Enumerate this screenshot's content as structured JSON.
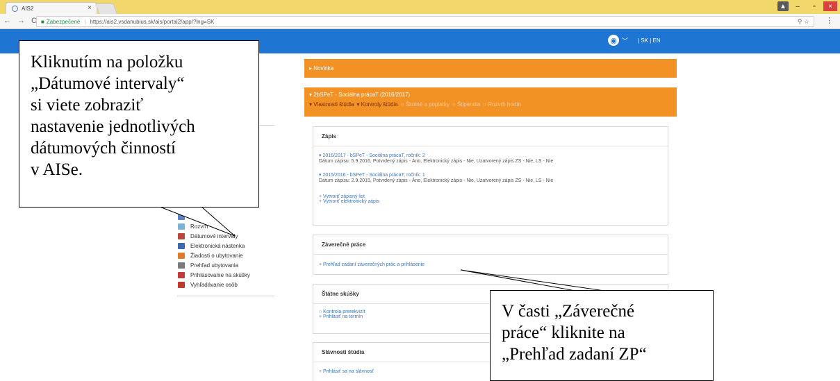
{
  "browser": {
    "tab_title": "AIS2",
    "tab_close": "×",
    "secure_label": "Zabezpečené",
    "separator": "|",
    "url": "https://ais2.vsdanubius.sk/ais/portal2/app/?lng=SK",
    "window_buttons": {
      "user": "▲",
      "minimize": "–",
      "maximize": "▫",
      "close": "×"
    },
    "nav": {
      "back": "←",
      "forward": "→",
      "reload": "C"
    },
    "omnibox_right": "⚲ ☆",
    "menu": "⋮"
  },
  "header": {
    "avatar": "◉",
    "chevron": "﹀",
    "lang_links": "| SK | EN"
  },
  "sidebar": {
    "items": [
      {
        "label": "...dmetov",
        "icon": "book-icon",
        "color": "#5b7fbf"
      },
      {
        "label": "Rozvrh",
        "icon": "schedule-icon",
        "color": "#7bb3d8"
      },
      {
        "label": "Dátumové intervaly",
        "icon": "calendar-icon",
        "color": "#b9473d"
      },
      {
        "label": "Elektronická nástenka",
        "icon": "board-icon",
        "color": "#3c68b0"
      },
      {
        "label": "Žiadosti o ubytovanie",
        "icon": "person-icon",
        "color": "#e07b2a"
      },
      {
        "label": "Prehľad ubytovania",
        "icon": "list-icon",
        "color": "#7a7a7a"
      },
      {
        "label": "Prihlasovanie na skúšky",
        "icon": "exam-icon",
        "color": "#c23b3b"
      },
      {
        "label": "Vyhľadávanie osôb",
        "icon": "people-icon",
        "color": "#c0392b"
      }
    ]
  },
  "main": {
    "novinka": "▸ Novinka",
    "study_title": "▾ 2bSPeT - Sociálna prácaT (2016/2017)",
    "study_links": [
      {
        "label": "▾ Vlastnosti štúdia",
        "active": true
      },
      {
        "label": "▾ Kontroly štúdia",
        "active": true
      },
      {
        "label": "○ Školné a poplatky",
        "active": false
      },
      {
        "label": "○ Štipendia",
        "active": false
      },
      {
        "label": "○ Rozvrh hodín",
        "active": false
      }
    ],
    "zapis": {
      "title": "Zápis",
      "entry1_link": "▾ 2016/2017 - bSPeT - Sociálna prácaT, ročník: 2",
      "entry1_text": "Dátum zápisu: 5.9.2016, Potvrdený zápis - Áno, Elektronický zápis - Nie, Uzatvorený zápis ZS - Nie, LS - Nie",
      "entry2_link": "▾ 2015/2016 - bSPeT - Sociálna prácaT, ročník: 1",
      "entry2_text": "Dátum zápisu: 2.9.2015, Potvrdený zápis - Áno, Elektronický zápis - Nie, Uzatvorený zápis ZS - Nie, LS - Nie",
      "action1": "+ Vytvoriť zápisný list",
      "action2": "+ Vytvoriť elektronický zápis"
    },
    "zaverecne": {
      "title": "Záverečné práce",
      "link": "+ Prehľad zadaní záverečných prác a prihlásenie"
    },
    "statne": {
      "title": "Štátne skúšky",
      "link1": "○ Kontrola prerekvizít",
      "link2": "+ Prihlásiť na termín"
    },
    "slavnosti": {
      "title": "Slávnosti štúdia",
      "link": "+ Prihlásiť sa na slávnosť"
    }
  },
  "callouts": {
    "first": [
      "Kliknutím na položku",
      "„Dátumové intervaly“",
      "si viete zobraziť",
      "nastavenie jednotlivých",
      "dátumových činností",
      "v AISe."
    ],
    "second": [
      "V časti „Záverečné",
      "práce“ kliknite na",
      "„Prehľad zadaní ZP“"
    ]
  }
}
